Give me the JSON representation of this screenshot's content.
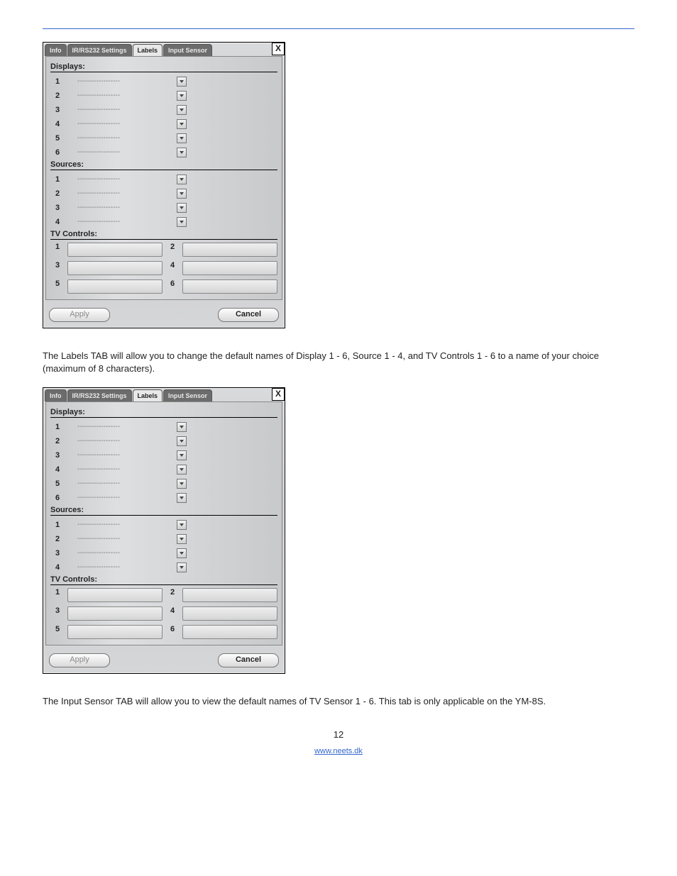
{
  "tabs": {
    "info": "Info",
    "ir": "IR/RS232 Settings",
    "labels": "Labels",
    "sensor": "Input Sensor"
  },
  "close_glyph": "X",
  "sections": {
    "displays": "Displays:",
    "sources": "Sources:",
    "tv": "TV Controls:"
  },
  "displays": [
    {
      "n": "1",
      "placeholder": "------------------"
    },
    {
      "n": "2",
      "placeholder": "------------------"
    },
    {
      "n": "3",
      "placeholder": "------------------"
    },
    {
      "n": "4",
      "placeholder": "------------------"
    },
    {
      "n": "5",
      "placeholder": "------------------"
    },
    {
      "n": "6",
      "placeholder": "------------------"
    }
  ],
  "sources": [
    {
      "n": "1",
      "placeholder": "------------------"
    },
    {
      "n": "2",
      "placeholder": "------------------"
    },
    {
      "n": "3",
      "placeholder": "------------------"
    },
    {
      "n": "4",
      "placeholder": "------------------"
    }
  ],
  "tv_numbers": [
    "1",
    "2",
    "3",
    "4",
    "5",
    "6"
  ],
  "buttons": {
    "apply": "Apply",
    "cancel": "Cancel"
  },
  "para1": "The Labels TAB will allow you to change the default names of Display 1 - 6, Source 1 - 4, and TV Controls 1 - 6 to a name of your choice (maximum of 8 characters).",
  "para2": "The Input Sensor TAB will allow you to view the default names of TV Sensor 1 - 6. This tab is only applicable on the YM-8S.",
  "page_number": "12",
  "footer_link": "www.neets.dk"
}
